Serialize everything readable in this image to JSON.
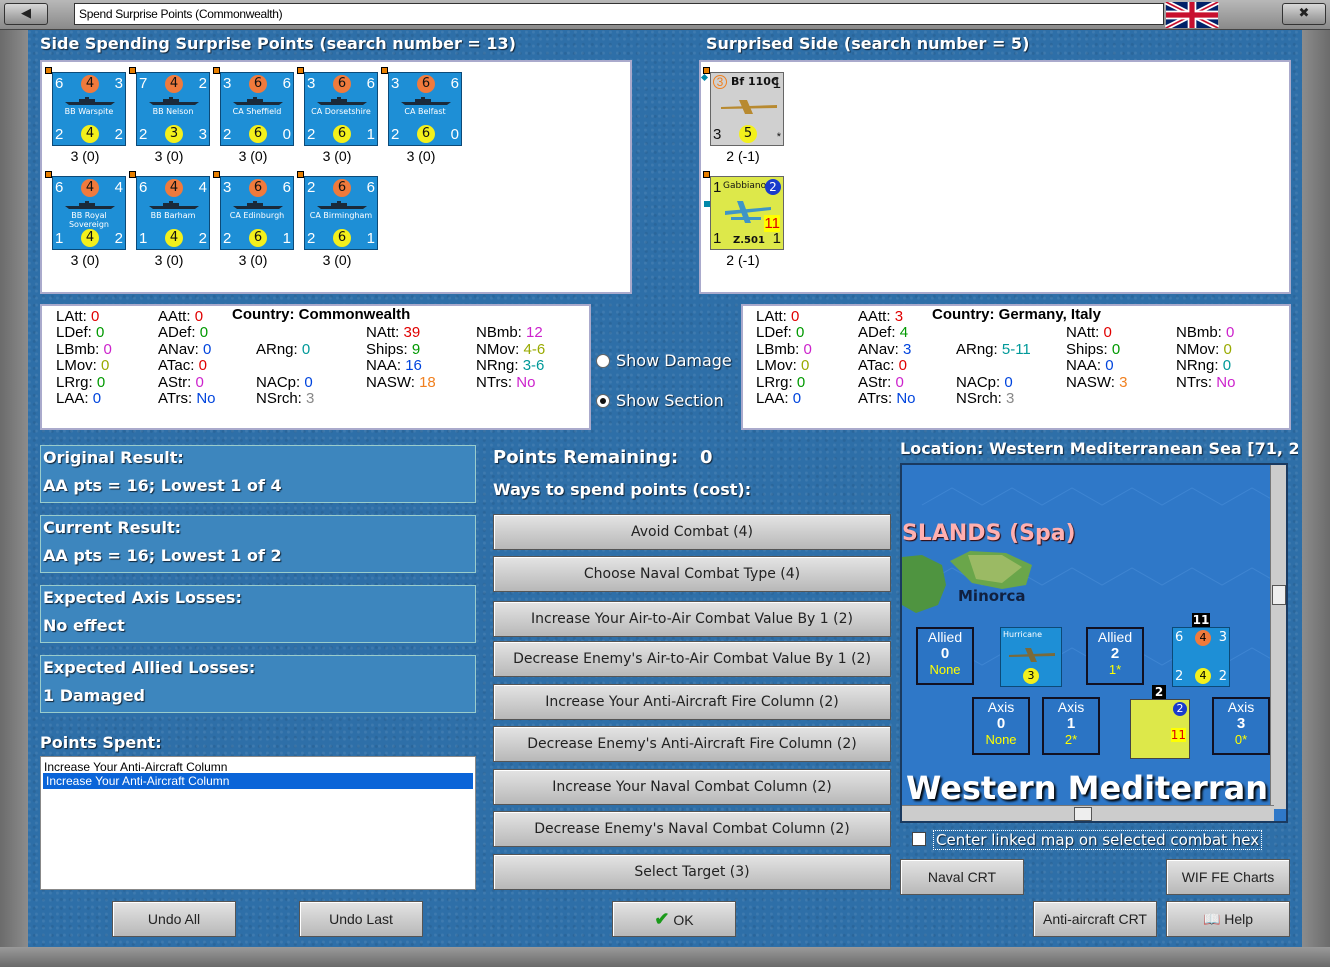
{
  "window": {
    "title": "Spend Surprise Points (Commonwealth)"
  },
  "left": {
    "heading": "Side Spending Surprise Points (search number = 13)",
    "units": [
      {
        "name": "BB Warspite",
        "tl": "6",
        "oc": "4",
        "tr": "3",
        "bl": "2",
        "yc": "4",
        "br": "2",
        "value": "3 (0)"
      },
      {
        "name": "BB Nelson",
        "tl": "7",
        "oc": "4",
        "tr": "2",
        "bl": "2",
        "yc": "3",
        "br": "3",
        "value": "3 (0)"
      },
      {
        "name": "CA Sheffield",
        "tl": "3",
        "oc": "6",
        "tr": "6",
        "bl": "2",
        "yc": "6",
        "br": "0",
        "value": "3 (0)"
      },
      {
        "name": "CA Dorsetshire",
        "tl": "3",
        "oc": "6",
        "tr": "6",
        "bl": "2",
        "yc": "6",
        "br": "1",
        "value": "3 (0)"
      },
      {
        "name": "CA Belfast",
        "tl": "3",
        "oc": "6",
        "tr": "6",
        "bl": "2",
        "yc": "6",
        "br": "0",
        "value": "3 (0)"
      },
      {
        "name": "BB Royal Sovereign",
        "tl": "6",
        "oc": "4",
        "tr": "4",
        "bl": "1",
        "yc": "4",
        "br": "2",
        "value": "3 (0)"
      },
      {
        "name": "BB Barham",
        "tl": "6",
        "oc": "4",
        "tr": "4",
        "bl": "1",
        "yc": "4",
        "br": "2",
        "value": "3 (0)"
      },
      {
        "name": "CA Edinburgh",
        "tl": "3",
        "oc": "6",
        "tr": "6",
        "bl": "2",
        "yc": "6",
        "br": "1",
        "value": "3 (0)"
      },
      {
        "name": "CA Birmingham",
        "tl": "2",
        "oc": "6",
        "tr": "6",
        "bl": "2",
        "yc": "6",
        "br": "1",
        "value": "3 (0)"
      }
    ],
    "stats": {
      "LAtt": "0",
      "LDef": "0",
      "LBmb": "0",
      "LMov": "0",
      "LRrg": "0",
      "LAA": "0",
      "AAtt": "0",
      "ADef": "0",
      "ANav": "0",
      "ATac": "0",
      "AStr": "0",
      "ATrs": "No",
      "country": "Country: Commonwealth",
      "ARng": "0",
      "NACp": "0",
      "NSrch": "3",
      "NAtt": "39",
      "Ships": "9",
      "NAA": "16",
      "NASW": "18",
      "NBmb": "12",
      "NMov": "4-6",
      "NRng": "3-6",
      "NTrs": "No"
    }
  },
  "right": {
    "heading": "Surprised Side (search number = 5)",
    "units": [
      {
        "name": "Bf 110C",
        "tl": "3",
        "tr": "1",
        "bl": "3",
        "yc": "5",
        "br": "*",
        "value": "2 (-1)"
      },
      {
        "name": "Gabbiano",
        "name2": "Z.501",
        "tl": "1",
        "tr": "2",
        "bl": "1",
        "yc": "11",
        "br": "1",
        "value": "2 (-1)"
      }
    ],
    "stats": {
      "LAtt": "0",
      "LDef": "0",
      "LBmb": "0",
      "LMov": "0",
      "LRrg": "0",
      "LAA": "0",
      "AAtt": "3",
      "ADef": "4",
      "ANav": "3",
      "ATac": "0",
      "AStr": "0",
      "ATrs": "No",
      "country": "Country: Germany, Italy",
      "ARng": "5-11",
      "NACp": "0",
      "NSrch": "3",
      "NAtt": "0",
      "Ships": "0",
      "NAA": "0",
      "NASW": "3",
      "NBmb": "0",
      "NMov": "0",
      "NRng": "0",
      "NTrs": "No"
    }
  },
  "options": {
    "show_damage": "Show Damage",
    "show_section": "Show Section"
  },
  "results": [
    {
      "label": "Original Result:",
      "value": "AA pts = 16; Lowest 1 of 4"
    },
    {
      "label": "Current Result:",
      "value": "AA pts = 16; Lowest 1 of 2"
    },
    {
      "label": "Expected Axis Losses:",
      "value": "No effect"
    },
    {
      "label": "Expected Allied Losses:",
      "value": "1 Damaged"
    }
  ],
  "points_spent": {
    "label": "Points Spent:",
    "items": [
      "Increase Your Anti-Aircraft Column",
      "Increase Your Anti-Aircraft Column"
    ]
  },
  "spend": {
    "remaining_label": "Points Remaining:",
    "remaining_value": "0",
    "ways_label": "Ways to spend points (cost):",
    "buttons": [
      "Avoid Combat (4)",
      "Choose Naval Combat Type (4)",
      "Increase Your Air-to-Air Combat Value By 1 (2)",
      "Decrease Enemy's Air-to-Air Combat Value By 1 (2)",
      "Increase Your Anti-Aircraft Fire Column (2)",
      "Decrease Enemy's Anti-Aircraft Fire Column (2)",
      "Increase Your Naval Combat Column (2)",
      "Decrease Enemy's Naval Combat Column (2)",
      "Select Target (3)"
    ]
  },
  "map": {
    "location": "Location: Western Mediterranean Sea [71, 2",
    "islands": "SLANDS (Spa)",
    "minorca": "Minorca",
    "sea": "Western Mediterran",
    "boxes": [
      {
        "side": "Allied",
        "num": "0",
        "sub": "None"
      },
      {
        "side": "Allied",
        "num": "2",
        "sub": "1*"
      },
      {
        "side": "Axis",
        "num": "0",
        "sub": "None"
      },
      {
        "side": "Axis",
        "num": "1",
        "sub": "2*"
      },
      {
        "side": "Axis",
        "num": "3",
        "sub": "0*"
      }
    ],
    "hurricane": "Hurricane",
    "stack1": "11",
    "stack2": "2",
    "center_checkbox": "Center linked map on selected combat hex"
  },
  "buttons": {
    "undo_all": "Undo All",
    "undo_last": "Undo Last",
    "ok": "OK",
    "naval_crt": "Naval CRT",
    "wif_fe": "WIF FE Charts",
    "aa_crt": "Anti-aircraft CRT",
    "help": "Help"
  }
}
